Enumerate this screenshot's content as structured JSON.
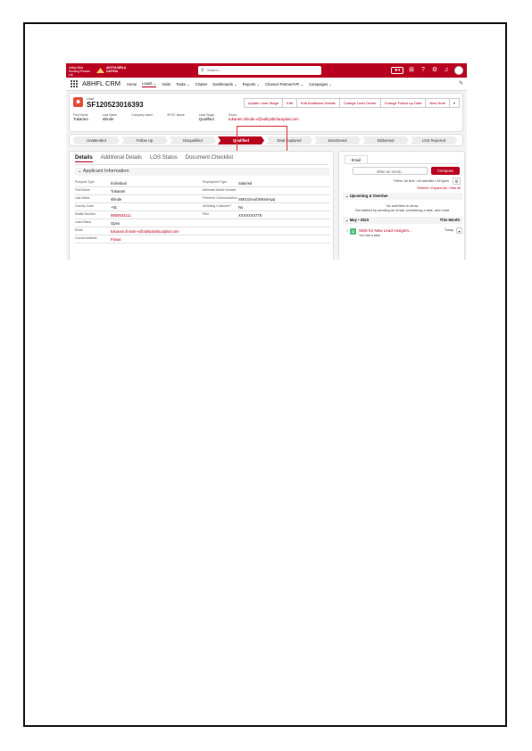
{
  "topbar": {
    "brand": "Aditya Birla Housing Finance Ltd.",
    "logo_line1": "ADITYA BIRLA",
    "logo_line2": "CAPITAL",
    "search_placeholder": "Search...",
    "icons": [
      "favorites-icon",
      "add-icon",
      "help-icon",
      "settings-icon",
      "notifications-icon",
      "avatar"
    ]
  },
  "nav": {
    "app_name": "ABHFL CRM",
    "items": [
      "Home",
      "Leads",
      "Visits",
      "Tasks",
      "Chatter",
      "Dashboards",
      "Reports",
      "Channel Partner/API",
      "Campaigns"
    ],
    "active": "Leads"
  },
  "header": {
    "object_type": "Lead",
    "title": "SF120523016393",
    "actions": [
      "Update Lead Stage",
      "Edit",
      "Edit Additional Details",
      "Change Lead Owner",
      "Change Follow up Date",
      "New Note"
    ],
    "fields": [
      {
        "label": "First Name",
        "value": "Tukaram"
      },
      {
        "label": "Last Name",
        "value": "shinde"
      },
      {
        "label": "Company name",
        "value": ""
      },
      {
        "label": "SPOC Name",
        "value": ""
      },
      {
        "label": "Lead Stage",
        "value": "Qualified"
      },
      {
        "label": "Email",
        "value": "tukaram.shinde-v@adityabirlacapital.com"
      }
    ]
  },
  "path": {
    "steps": [
      "Unattended",
      "Follow Up",
      "Disqualified",
      "Qualified",
      "Deal Captured",
      "Sanctioned",
      "Disbursed",
      "LOS Rejected"
    ],
    "current": "Qualified"
  },
  "details": {
    "tabs": [
      "Details",
      "Additional Details",
      "LOS Status",
      "Document Checklist"
    ],
    "active_tab": "Details",
    "section_title": "Applicant Information",
    "rows": [
      [
        {
          "label": "Prospect Type",
          "value": "Individual"
        },
        {
          "label": "Employment Type",
          "value": "Salaried"
        }
      ],
      [
        {
          "label": "First Name",
          "value": "Tukaram"
        },
        {
          "label": "Alternate Mobile Number",
          "value": ""
        }
      ],
      [
        {
          "label": "Last Name",
          "value": "shinde"
        },
        {
          "label": "Preferred Communication",
          "value": "SMS;Email;WhatsApp"
        }
      ],
      [
        {
          "label": "Country Code",
          "value": "+91"
        },
        {
          "label": "isExisting Customer?",
          "value": "No"
        }
      ],
      [
        {
          "label": "Mobile Number",
          "value": "9850834111"
        },
        {
          "label": "PAN",
          "value": "XXXXXX4778"
        }
      ],
      [
        {
          "label": "Lead Status",
          "value": "Open"
        },
        {
          "label": "",
          "value": ""
        }
      ],
      [
        {
          "label": "Email",
          "value": "tukaram.shinde-v@adityabirlacapital.com"
        },
        {
          "label": "",
          "value": ""
        }
      ],
      [
        {
          "label": "Current Address",
          "value": "Powai"
        },
        {
          "label": "",
          "value": ""
        }
      ]
    ]
  },
  "activity": {
    "tab": "Email",
    "email_placeholder": "Write an email...",
    "compose": "Compose",
    "filters": "Filters: All time • All activities • All types",
    "links": "Refresh • Expand All • View All",
    "upcoming_title": "Upcoming & Overdue",
    "no_activities": "No activities to show.",
    "get_started": "Get started by sending an email, scheduling a task, and more.",
    "month_title": "May • 2023",
    "month_right": "This Month",
    "task_title": "SMS for New Lead Assignm...",
    "task_desc": "You had a task",
    "task_day": "Today"
  },
  "colors": {
    "brand": "#b8001f",
    "highlight": "#e0353a"
  }
}
